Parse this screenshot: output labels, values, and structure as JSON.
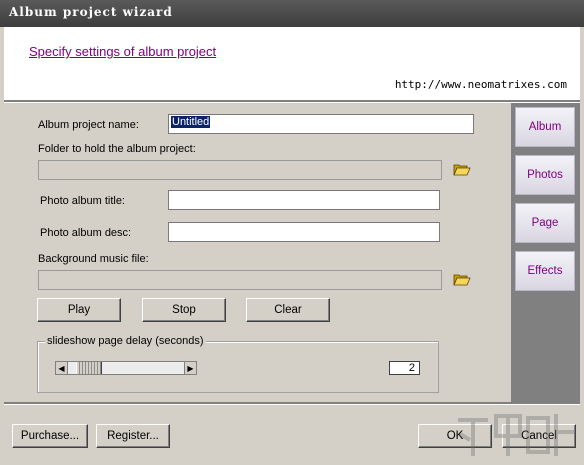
{
  "window": {
    "title": "Album project wizard"
  },
  "header": {
    "subtitle": "Specify settings of album project",
    "url": "http://www.neomatrixes.com"
  },
  "form": {
    "project_name_label": "Album project name:",
    "project_name_value": "Untitled",
    "folder_label": "Folder to hold the album project:",
    "folder_value": "",
    "photo_title_label": "Photo album title:",
    "photo_title_value": "",
    "photo_desc_label": "Photo album desc:",
    "photo_desc_value": "",
    "music_label": "Background music file:",
    "music_value": ""
  },
  "music_buttons": {
    "play": "Play",
    "stop": "Stop",
    "clear": "Clear"
  },
  "delay": {
    "group_label": "slideshow page delay (seconds)",
    "value": "2",
    "slider_level": 0.1
  },
  "sidebar": {
    "items": [
      "Album",
      "Photos",
      "Page",
      "Effects"
    ]
  },
  "footer": {
    "purchase": "Purchase...",
    "register": "Register...",
    "ok": "OK",
    "cancel": "Cancel"
  },
  "icons": {
    "folder1": "open-folder-icon",
    "folder2": "open-folder-icon"
  }
}
